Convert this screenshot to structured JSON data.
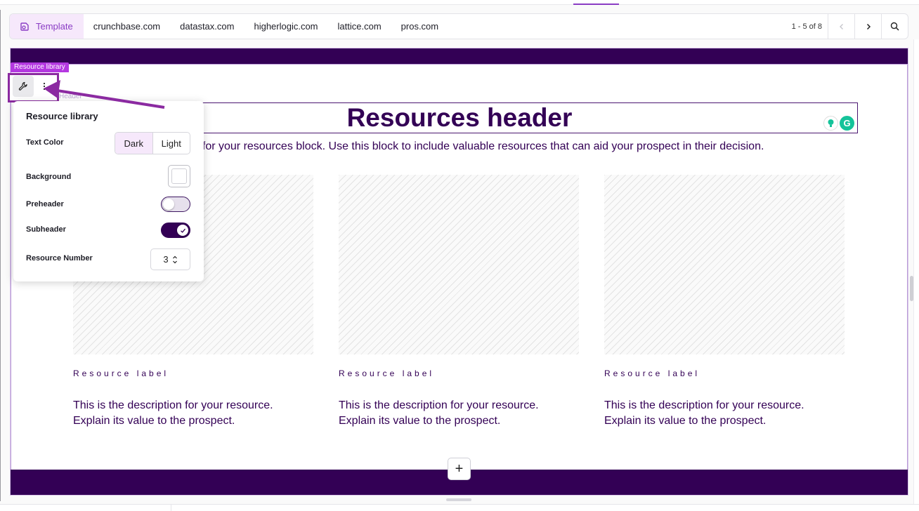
{
  "tabs": {
    "active": {
      "label": "Template",
      "icon": "template-icon"
    },
    "items": [
      "crunchbase.com",
      "datastax.com",
      "higherlogic.com",
      "lattice.com",
      "pros.com"
    ]
  },
  "pager": {
    "text": "1 - 5 of 8",
    "prev_icon": "chevron-left-icon",
    "next_icon": "chevron-right-icon",
    "search_icon": "search-icon"
  },
  "block": {
    "tag": "Resource library",
    "ghost_label": "Header",
    "title": "Resources header",
    "subheader": "t for your resources block. Use this block to include valuable resources that can aid your prospect in their decision.",
    "cards": [
      {
        "label": "Resource label",
        "desc_line1": "This is the description for your resource.",
        "desc_line2": "Explain its value to the prospect."
      },
      {
        "label": "Resource label",
        "desc_line1": "This is the description for your resource.",
        "desc_line2": "Explain its value to the prospect."
      },
      {
        "label": "Resource label",
        "desc_line1": "This is the description for your resource.",
        "desc_line2": "Explain its value to the prospect."
      }
    ],
    "add_label": "+"
  },
  "panel": {
    "title": "Resource library",
    "text_color_label": "Text Color",
    "text_color_options": [
      "Dark",
      "Light"
    ],
    "text_color_selected": "Dark",
    "background_label": "Background",
    "background_color": "#ffffff",
    "preheader_label": "Preheader",
    "preheader_on": false,
    "subheader_label": "Subheader",
    "subheader_on": true,
    "resource_number_label": "Resource Number",
    "resource_number": "3"
  },
  "colors": {
    "brand_dark": "#330055",
    "accent": "#8a3cc4",
    "tag": "#b438e0",
    "annotation": "#8b2aa1"
  }
}
